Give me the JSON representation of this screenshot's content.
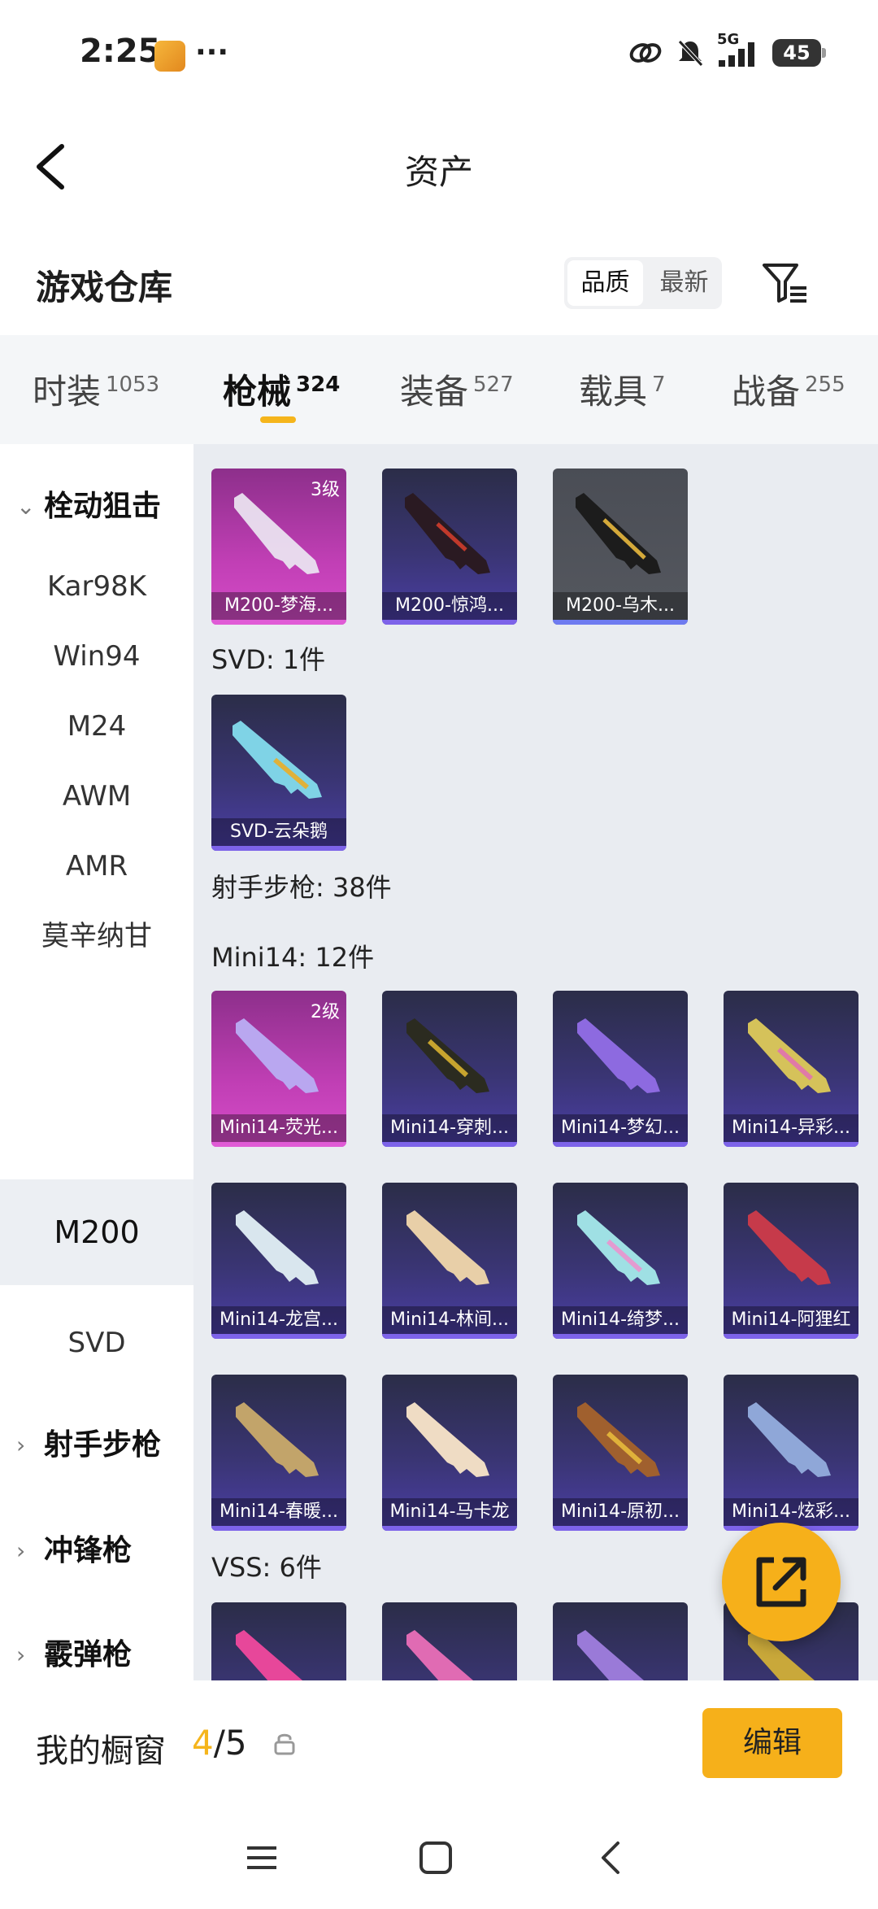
{
  "status_bar": {
    "time": "2:25",
    "dots": "···",
    "network": "5G",
    "battery": "45"
  },
  "header": {
    "title": "资产"
  },
  "warehouse": {
    "title": "游戏仓库",
    "sort_options": [
      "品质",
      "最新"
    ]
  },
  "tabs": [
    {
      "label": "时装",
      "count": "1053"
    },
    {
      "label": "枪械",
      "count": "324",
      "active": true
    },
    {
      "label": "装备",
      "count": "527"
    },
    {
      "label": "载具",
      "count": "7"
    },
    {
      "label": "战备",
      "count": "255"
    }
  ],
  "sidebar": {
    "items": [
      {
        "label": "栓动狙击",
        "type": "group-expanded"
      },
      {
        "label": "Kar98K"
      },
      {
        "label": "Win94"
      },
      {
        "label": "M24"
      },
      {
        "label": "AWM"
      },
      {
        "label": "AMR"
      },
      {
        "label": "莫辛纳甘"
      },
      {
        "label": "M200",
        "active": true
      },
      {
        "label": "SVD"
      },
      {
        "label": "射手步枪",
        "type": "group-collapsed"
      },
      {
        "label": "冲锋枪",
        "type": "group-collapsed"
      },
      {
        "label": "霰弹枪",
        "type": "group-collapsed"
      }
    ]
  },
  "content": {
    "sections": [
      {
        "label": "",
        "items": [
          {
            "name": "M200-梦海...",
            "level": "3级",
            "rarity": "pink"
          },
          {
            "name": "M200-惊鸿...",
            "rarity": "purple"
          },
          {
            "name": "M200-乌木...",
            "rarity": "grey"
          }
        ]
      },
      {
        "label": "SVD: 1件",
        "items": [
          {
            "name": "SVD-云朵鹅",
            "rarity": "purple"
          }
        ]
      },
      {
        "label": "射手步枪: 38件",
        "items": []
      },
      {
        "label": "Mini14: 12件",
        "items": [
          {
            "name": "Mini14-荧光...",
            "level": "2级",
            "rarity": "pink"
          },
          {
            "name": "Mini14-穿刺...",
            "rarity": "purple"
          },
          {
            "name": "Mini14-梦幻...",
            "rarity": "purple"
          },
          {
            "name": "Mini14-异彩...",
            "rarity": "purple"
          },
          {
            "name": "Mini14-龙宫...",
            "rarity": "purple"
          },
          {
            "name": "Mini14-林间...",
            "rarity": "purple"
          },
          {
            "name": "Mini14-绮梦...",
            "rarity": "purple"
          },
          {
            "name": "Mini14-阿狸红",
            "rarity": "purple"
          },
          {
            "name": "Mini14-春暖...",
            "rarity": "purple"
          },
          {
            "name": "Mini14-马卡龙",
            "rarity": "purple"
          },
          {
            "name": "Mini14-原初...",
            "rarity": "purple"
          },
          {
            "name": "Mini14-炫彩...",
            "rarity": "purple"
          }
        ]
      },
      {
        "label": "VSS: 6件",
        "items": [
          {
            "name": "",
            "rarity": "purple"
          },
          {
            "name": "",
            "rarity": "purple"
          },
          {
            "name": "",
            "rarity": "purple"
          },
          {
            "name": "",
            "rarity": "purple"
          }
        ]
      }
    ]
  },
  "showcase": {
    "label": "我的橱窗",
    "current": "4",
    "total": "/5",
    "edit_label": "编辑"
  },
  "colors": {
    "accent": "#f6b01a",
    "pink_rarity": "#c13fb5",
    "purple_rarity": "#3a3574",
    "grey_rarity": "#55585f"
  }
}
